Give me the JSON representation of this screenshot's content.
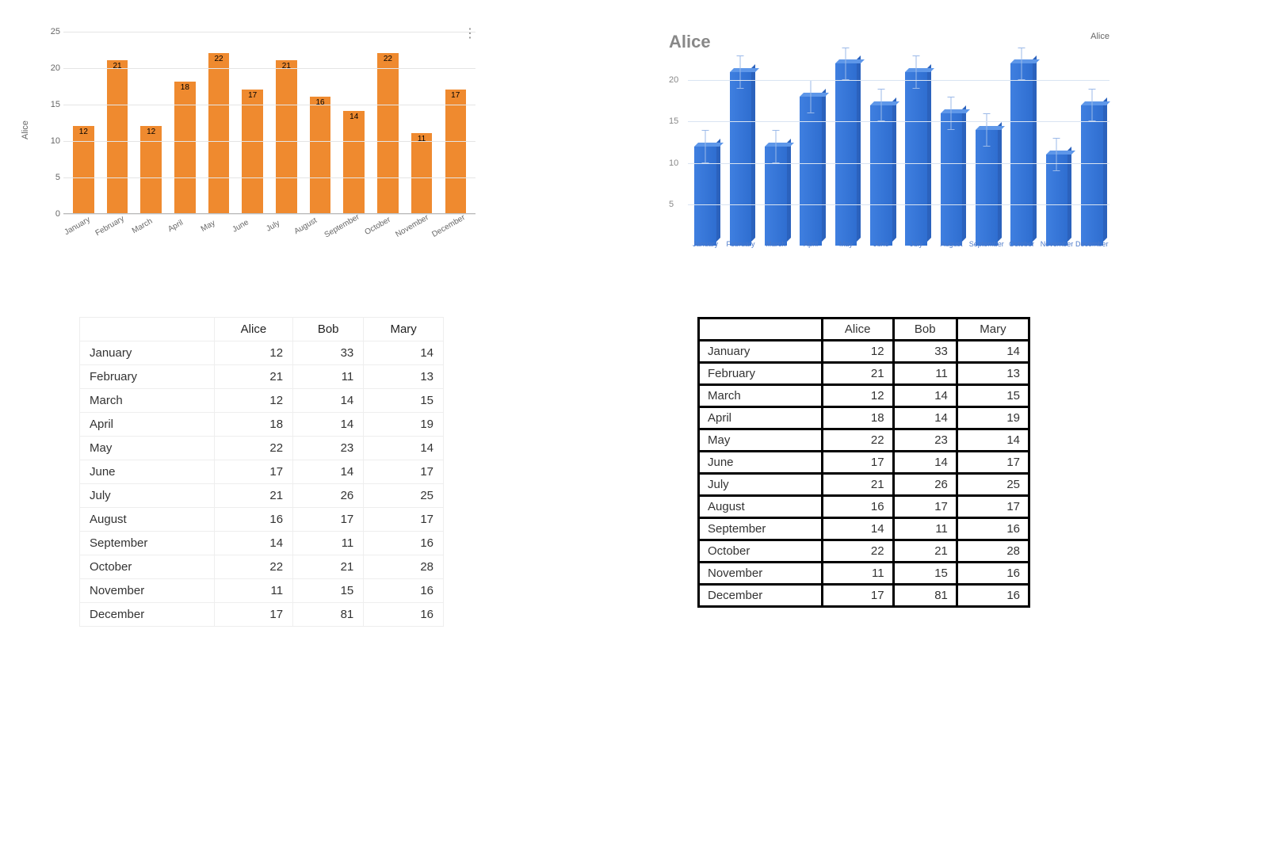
{
  "chart_data": [
    {
      "id": "orange",
      "type": "bar",
      "title": "",
      "ylabel": "Alice",
      "xlabel": "",
      "ylim": [
        0,
        25
      ],
      "yticks": [
        0,
        5,
        10,
        15,
        20,
        25
      ],
      "categories": [
        "January",
        "February",
        "March",
        "April",
        "May",
        "June",
        "July",
        "August",
        "September",
        "October",
        "November",
        "December"
      ],
      "values": [
        12,
        21,
        12,
        18,
        22,
        17,
        21,
        16,
        14,
        22,
        11,
        17
      ],
      "color": "#ef8a2f"
    },
    {
      "id": "blue",
      "type": "bar",
      "title": "Alice",
      "legend": "Alice",
      "ylabel": "",
      "ylim": [
        0,
        23
      ],
      "yticks": [
        5,
        10,
        15,
        20
      ],
      "categories": [
        "January",
        "February",
        "March",
        "April",
        "May",
        "June",
        "July",
        "August",
        "September",
        "October",
        "November",
        "December"
      ],
      "values": [
        12,
        21,
        12,
        18,
        22,
        17,
        21,
        16,
        14,
        22,
        11,
        17
      ],
      "error": 2,
      "color": "#3f7fe0"
    }
  ],
  "table": {
    "columns": [
      "",
      "Alice",
      "Bob",
      "Mary"
    ],
    "rows": [
      {
        "month": "January",
        "Alice": 12,
        "Bob": 33,
        "Mary": 14
      },
      {
        "month": "February",
        "Alice": 21,
        "Bob": 11,
        "Mary": 13
      },
      {
        "month": "March",
        "Alice": 12,
        "Bob": 14,
        "Mary": 15
      },
      {
        "month": "April",
        "Alice": 18,
        "Bob": 14,
        "Mary": 19
      },
      {
        "month": "May",
        "Alice": 22,
        "Bob": 23,
        "Mary": 14
      },
      {
        "month": "June",
        "Alice": 17,
        "Bob": 14,
        "Mary": 17
      },
      {
        "month": "July",
        "Alice": 21,
        "Bob": 26,
        "Mary": 25
      },
      {
        "month": "August",
        "Alice": 16,
        "Bob": 17,
        "Mary": 17
      },
      {
        "month": "September",
        "Alice": 14,
        "Bob": 11,
        "Mary": 16
      },
      {
        "month": "October",
        "Alice": 22,
        "Bob": 21,
        "Mary": 28
      },
      {
        "month": "November",
        "Alice": 11,
        "Bob": 15,
        "Mary": 16
      },
      {
        "month": "December",
        "Alice": 17,
        "Bob": 81,
        "Mary": 16
      }
    ]
  }
}
